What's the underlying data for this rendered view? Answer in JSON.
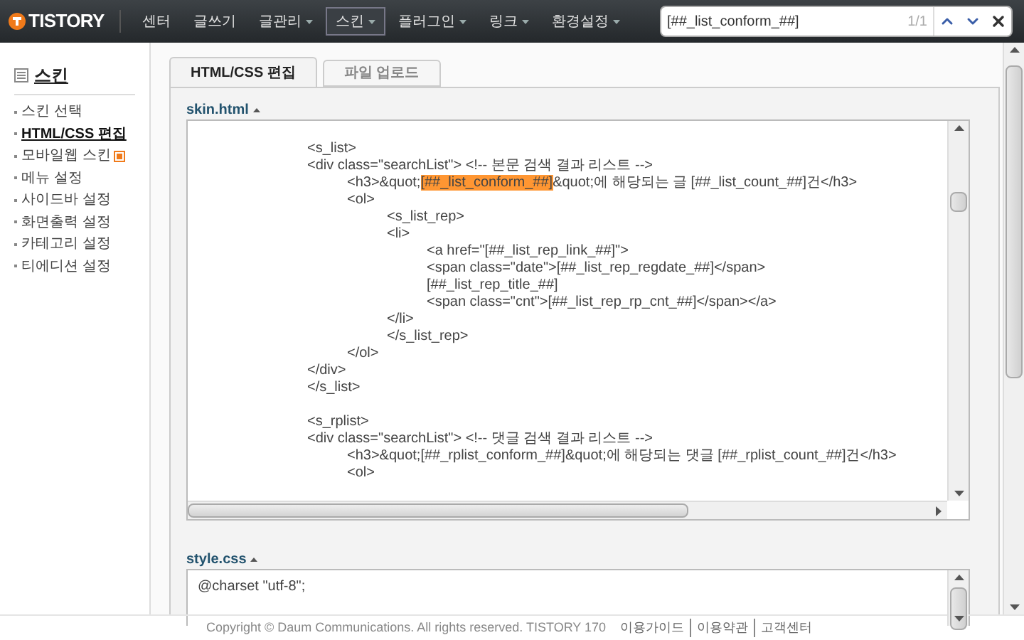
{
  "nav": {
    "logo": "TISTORY",
    "items": [
      {
        "label": "센터",
        "dropdown": false,
        "selected": false
      },
      {
        "label": "글쓰기",
        "dropdown": false,
        "selected": false
      },
      {
        "label": "글관리",
        "dropdown": true,
        "selected": false
      },
      {
        "label": "스킨",
        "dropdown": true,
        "selected": true
      },
      {
        "label": "플러그인",
        "dropdown": true,
        "selected": false
      },
      {
        "label": "링크",
        "dropdown": true,
        "selected": false
      },
      {
        "label": "환경설정",
        "dropdown": true,
        "selected": false
      }
    ]
  },
  "find_bar": {
    "value": "[##_list_conform_##]",
    "count": "1/1"
  },
  "sidebar": {
    "title": "스킨",
    "items": [
      {
        "label": "스킨 선택",
        "selected": false,
        "new": false
      },
      {
        "label": "HTML/CSS 편집",
        "selected": true,
        "new": false
      },
      {
        "label": "모바일웹 스킨",
        "selected": false,
        "new": true
      },
      {
        "label": "메뉴 설정",
        "selected": false,
        "new": false
      },
      {
        "label": "사이드바 설정",
        "selected": false,
        "new": false
      },
      {
        "label": "화면출력 설정",
        "selected": false,
        "new": false
      },
      {
        "label": "카테고리 설정",
        "selected": false,
        "new": false
      },
      {
        "label": "티에디션 설정",
        "selected": false,
        "new": false
      }
    ]
  },
  "tabs": [
    {
      "label": "HTML/CSS 편집",
      "selected": true
    },
    {
      "label": "파일 업로드",
      "selected": false
    }
  ],
  "editors": [
    {
      "title": "skin.html",
      "lines": [
        {
          "text": "<s_list>"
        },
        {
          "text": "<div class=\"searchList\"> <!-- 본문 검색 결과 리스트 -->"
        },
        {
          "parts": [
            {
              "text": "\t<h3>&quot;",
              "highlighted": false
            },
            {
              "text": "[##_list_conform_##]",
              "highlighted": true
            },
            {
              "text": "&quot;에 해당되는 글 [##_list_count_##]건</h3>",
              "highlighted": false
            }
          ]
        },
        {
          "text": "\t<ol>"
        },
        {
          "text": "\t\t<s_list_rep>"
        },
        {
          "text": "\t\t<li>"
        },
        {
          "text": "\t\t\t<a href=\"[##_list_rep_link_##]\">"
        },
        {
          "text": "\t\t\t<span class=\"date\">[##_list_rep_regdate_##]</span>"
        },
        {
          "text": "\t\t\t[##_list_rep_title_##]"
        },
        {
          "text": "\t\t\t<span class=\"cnt\">[##_list_rep_rp_cnt_##]</span></a>"
        },
        {
          "text": "\t\t</li>"
        },
        {
          "text": "\t\t</s_list_rep>"
        },
        {
          "text": "\t</ol>"
        },
        {
          "text": "</div>"
        },
        {
          "text": "</s_list>"
        },
        {
          "kind": "blank"
        },
        {
          "text": "<s_rplist>"
        },
        {
          "text": "<div class=\"searchList\"> <!-- 댓글 검색 결과 리스트 -->"
        },
        {
          "text": "\t<h3>&quot;[##_rplist_conform_##]&quot;에 해당되는 댓글 [##_rplist_count_##]건</h3>"
        },
        {
          "text": "\t<ol>"
        }
      ]
    },
    {
      "title": "style.css",
      "lines": [
        {
          "text": "@charset \"utf-8\";"
        }
      ]
    }
  ],
  "footer": {
    "copyright": "Copyright © Daum Communications. All rights reserved. TISTORY 170",
    "links": [
      "이용가이드",
      "이용약관",
      "고객센터"
    ]
  }
}
